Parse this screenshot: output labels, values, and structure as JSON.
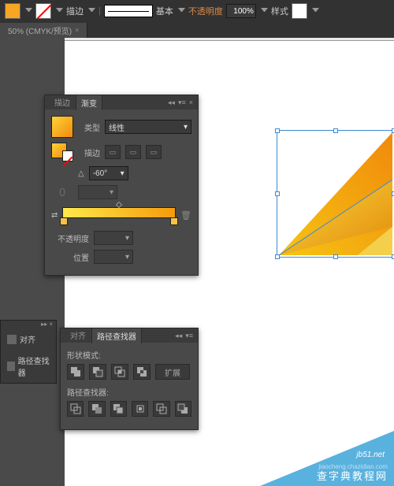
{
  "toolbar": {
    "stroke_label": "描边",
    "stroke_style_label": "基本",
    "opacity_label": "不透明度",
    "opacity_value": "100%",
    "style_label": "样式"
  },
  "document": {
    "tab_title": "50% (CMYK/预览)"
  },
  "gradient_panel": {
    "tab_stroke": "描边",
    "tab_gradient": "渐变",
    "type_label": "类型",
    "type_value": "线性",
    "stroke_label": "描边",
    "angle_value": "-60°",
    "opacity_label": "不透明度",
    "location_label": "位置"
  },
  "side_dock": {
    "align": "对齐",
    "pathfinder": "路径查找器"
  },
  "pathfinder": {
    "tab_align": "对齐",
    "tab_pathfinder": "路径查找器",
    "shape_modes": "形状模式:",
    "expand": "扩展",
    "pathfinders": "路径查找器:"
  },
  "watermark": {
    "line1": "jb51.net",
    "line2": "jiaocheng.chazidian.com",
    "line3": "查字典教程网"
  }
}
